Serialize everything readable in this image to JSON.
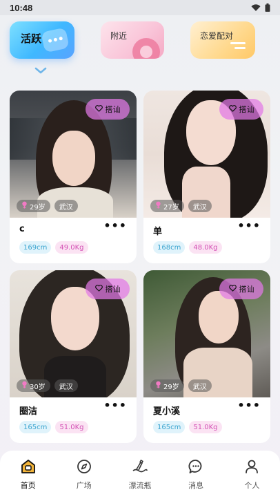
{
  "status": {
    "time": "10:48"
  },
  "tabs": [
    {
      "label": "活跃",
      "active": true
    },
    {
      "label": "附近",
      "active": false
    },
    {
      "label": "恋爱配对",
      "active": false
    }
  ],
  "cards": [
    {
      "name": "c",
      "age": "29岁",
      "city": "武汉",
      "height": "169cm",
      "weight": "49.0Kg",
      "greet": "搭讪",
      "more": "•••"
    },
    {
      "name": "单",
      "age": "27岁",
      "city": "武汉",
      "height": "168cm",
      "weight": "48.0Kg",
      "greet": "搭讪",
      "more": "•••"
    },
    {
      "name": "圈洁",
      "age": "30岁",
      "city": "武汉",
      "height": "165cm",
      "weight": "51.0Kg",
      "greet": "搭讪",
      "more": "•••"
    },
    {
      "name": "夏小溪",
      "age": "29岁",
      "city": "武汉",
      "height": "165cm",
      "weight": "51.0Kg",
      "greet": "搭讪",
      "more": "•••"
    }
  ],
  "nav": [
    {
      "label": "首页",
      "icon": "home-icon",
      "active": true
    },
    {
      "label": "广场",
      "icon": "compass-icon",
      "active": false
    },
    {
      "label": "漂流瓶",
      "icon": "drift-bottle-icon",
      "active": false
    },
    {
      "label": "消息",
      "icon": "message-icon",
      "active": false
    },
    {
      "label": "个人",
      "icon": "person-icon",
      "active": false
    }
  ],
  "colors": {
    "active_tab": "#3fb8ff",
    "nearby_tab": "#f9c4d8",
    "match_tab": "#ffd98e",
    "greet_button": "#e278e6",
    "height_tag": "#3aa4cf",
    "weight_tag": "#d34fb4",
    "nav_active": "#f2b43a"
  }
}
